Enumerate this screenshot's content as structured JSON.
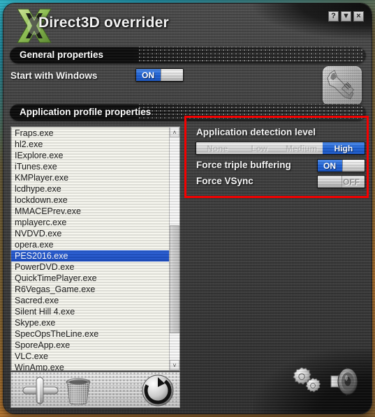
{
  "window": {
    "title": "Direct3D overrider",
    "logo_icon": "directx-x-logo",
    "controls": [
      {
        "name": "help-button",
        "label": "?"
      },
      {
        "name": "minimize-button",
        "label": "▼"
      },
      {
        "name": "close-button",
        "label": "×"
      }
    ]
  },
  "general_properties": {
    "section_title": "General properties",
    "start_with_windows": {
      "label": "Start with Windows",
      "value": "ON"
    },
    "wrench_icon": "wrench-icon"
  },
  "application_profile": {
    "section_title": "Application profile properties",
    "list": [
      "Fraps.exe",
      "hl2.exe",
      "IExplore.exe",
      "iTunes.exe",
      "KMPlayer.exe",
      "lcdhype.exe",
      "lockdown.exe",
      "MMACEPrev.exe",
      "mplayerc.exe",
      "NVDVD.exe",
      "opera.exe",
      "PES2016.exe",
      "PowerDVD.exe",
      "QuickTimePlayer.exe",
      "R6Vegas_Game.exe",
      "Sacred.exe",
      "Silent Hill 4.exe",
      "Skype.exe",
      "SpecOpsTheLine.exe",
      "SporeApp.exe",
      "VLC.exe",
      "WinAmp.exe"
    ],
    "selected": "PES2016.exe",
    "scrollbar": {
      "up_arrow": "˄",
      "down_arrow": "˅"
    },
    "toolbar": [
      {
        "name": "add-profile-button",
        "icon": "plus-icon"
      },
      {
        "name": "delete-profile-button",
        "icon": "trash-bin-icon"
      },
      {
        "name": "refresh-profiles-button",
        "icon": "refresh-circular-arrow-icon"
      }
    ]
  },
  "detection_panel": {
    "title": "Application detection level",
    "levels": [
      "None",
      "Low",
      "Medium",
      "High"
    ],
    "selected_level": "High",
    "rows": [
      {
        "label": "Force triple buffering",
        "value": "ON"
      },
      {
        "label": "Force VSync",
        "value": "OFF"
      }
    ],
    "highlight_color": "#f50000"
  },
  "status_bar": {
    "buttons": [
      {
        "name": "settings-button",
        "icon": "gears-icon"
      },
      {
        "name": "sound-button",
        "icon": "speaker-icon"
      }
    ]
  },
  "colors": {
    "accent_blue": "#1f63d8",
    "window_gray": "#3e3e3e",
    "list_background": "#f6f6ee",
    "annotation_red": "#f50000"
  }
}
